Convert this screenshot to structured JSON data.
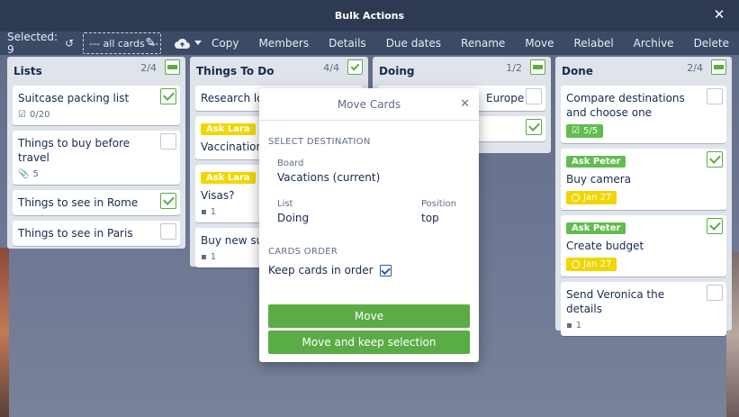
{
  "window": {
    "title": "Bulk Actions",
    "close_icon": "close-icon"
  },
  "toolbar": {
    "selected_label": "Selected: 9",
    "filter_value": "--- all cards ---",
    "actions": [
      "Copy",
      "Members",
      "Details",
      "Due dates",
      "Rename",
      "Move",
      "Relabel",
      "Archive",
      "Delete"
    ]
  },
  "lists": [
    {
      "title": "Lists",
      "count": "2/4",
      "cards": [
        {
          "title": "Suitcase packing list",
          "checked": true,
          "badge": "0/20"
        },
        {
          "title": "Things to buy before travel",
          "checked": false,
          "badge": "5"
        },
        {
          "title": "Things to see in Rome",
          "checked": true
        },
        {
          "title": "Things to see in Paris",
          "checked": false
        }
      ]
    },
    {
      "title": "Things To Do",
      "count": "4/4",
      "cards": [
        {
          "title": "Research loc",
          "checked": false
        },
        {
          "label": "Ask Lara",
          "title": "Vaccinations",
          "checked": false
        },
        {
          "label": "Ask Lara",
          "title": "Visas?",
          "badge": "1"
        },
        {
          "title": "Buy new suit",
          "badge": "1"
        }
      ]
    },
    {
      "title": "Doing",
      "count": "1/2",
      "cards": [
        {
          "title": "Europe",
          "checked": false
        },
        {
          "title": "",
          "checked": true
        }
      ]
    },
    {
      "title": "Done",
      "count": "2/4",
      "cards": [
        {
          "title": "Compare destinations and choose one",
          "checked": false,
          "badge": "5/5"
        },
        {
          "label": "Ask Peter",
          "title": "Buy camera",
          "checked": true,
          "due": "Jan 27"
        },
        {
          "label": "Ask Peter",
          "title": "Create budget",
          "checked": true,
          "due": "Jan 27"
        },
        {
          "title": "Send Veronica the details",
          "checked": false,
          "badge": "1"
        }
      ]
    }
  ],
  "modal": {
    "title": "Move Cards",
    "select_destination": "SELECT DESTINATION",
    "board_label": "Board",
    "board_value": "Vacations (current)",
    "list_label": "List",
    "list_value": "Doing",
    "position_label": "Position",
    "position_value": "top",
    "cards_order": "CARDS ORDER",
    "keep_order": "Keep cards in order",
    "move_button": "Move",
    "move_keep_button": "Move and keep selection"
  },
  "colors": {
    "green": "#5aac44",
    "yellow": "#f2d600",
    "titlebar": "#2e3a52",
    "toolbar": "#3c4a66"
  }
}
